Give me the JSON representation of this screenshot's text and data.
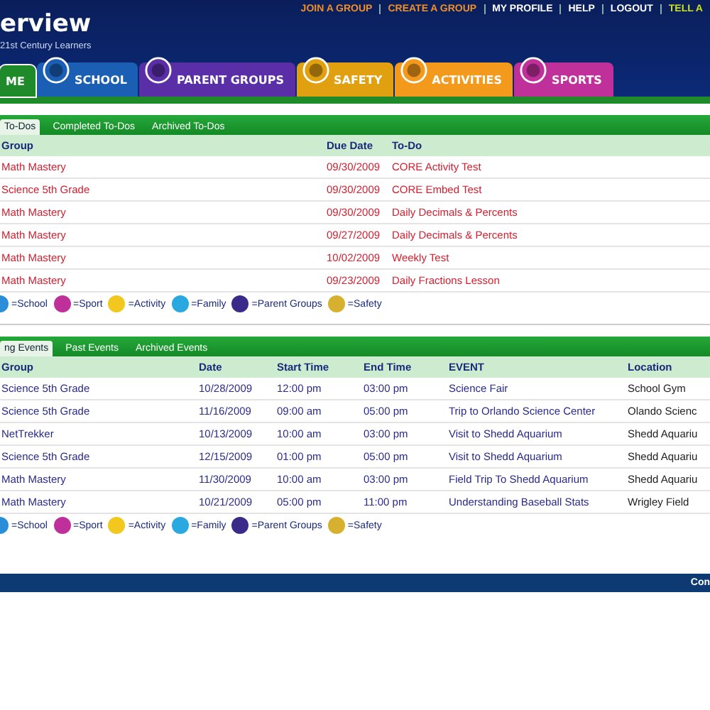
{
  "header": {
    "title": "erview",
    "subtitle": "21st Century Learners",
    "links": [
      {
        "label": "JOIN A GROUP",
        "kind": "accent"
      },
      {
        "label": "CREATE A GROUP",
        "kind": "accent"
      },
      {
        "label": "MY PROFILE",
        "kind": "plain"
      },
      {
        "label": "HELP",
        "kind": "plain"
      },
      {
        "label": "LOGOUT",
        "kind": "plain"
      },
      {
        "label": "TELL A",
        "kind": "highlight"
      }
    ]
  },
  "nav_tabs": [
    {
      "label": "ME",
      "color": "#1f8a2a",
      "selected": true,
      "icon": false
    },
    {
      "label": "SCHOOL",
      "color": "#1a5fb4",
      "selected": false,
      "icon": true
    },
    {
      "label": "PARENT GROUPS",
      "color": "#5a2ea6",
      "selected": false,
      "icon": true
    },
    {
      "label": "SAFETY",
      "color": "#e0a010",
      "selected": false,
      "icon": true
    },
    {
      "label": "ACTIVITIES",
      "color": "#f39a1c",
      "selected": false,
      "icon": true
    },
    {
      "label": "SPORTS",
      "color": "#c0309a",
      "selected": false,
      "icon": true
    }
  ],
  "todos": {
    "tabs": [
      {
        "label": "To-Dos",
        "selected": true
      },
      {
        "label": "Completed To-Dos",
        "selected": false
      },
      {
        "label": "Archived To-Dos",
        "selected": false
      }
    ],
    "columns": [
      "Group",
      "Due Date",
      "To-Do"
    ],
    "rows": [
      [
        "Math Mastery",
        "09/30/2009",
        "CORE Activity Test"
      ],
      [
        "Science 5th Grade",
        "09/30/2009",
        "CORE Embed Test"
      ],
      [
        "Math Mastery",
        "09/30/2009",
        "Daily Decimals & Percents"
      ],
      [
        "Math Mastery",
        "09/27/2009",
        "Daily Decimals & Percents"
      ],
      [
        "Math Mastery",
        "10/02/2009",
        "Weekly Test"
      ],
      [
        "Math Mastery",
        "09/23/2009",
        "Daily Fractions Lesson"
      ]
    ],
    "legend": [
      {
        "label": "=School",
        "color": "#2a8fd8"
      },
      {
        "label": "=Sport",
        "color": "#c0309a"
      },
      {
        "label": "=Activity",
        "color": "#f2c81e"
      },
      {
        "label": "=Family",
        "color": "#2aa8e0"
      },
      {
        "label": "=Parent Groups",
        "color": "#3a2a8a"
      },
      {
        "label": "=Safety",
        "color": "#d8b030"
      }
    ]
  },
  "events": {
    "tabs": [
      {
        "label": "ng Events",
        "selected": true
      },
      {
        "label": "Past Events",
        "selected": false
      },
      {
        "label": "Archived Events",
        "selected": false
      }
    ],
    "columns": [
      "Group",
      "Date",
      "Start Time",
      "End Time",
      "EVENT",
      "Location"
    ],
    "rows": [
      [
        "Science 5th Grade",
        "10/28/2009",
        "12:00 pm",
        "03:00 pm",
        "Science Fair",
        "School Gym"
      ],
      [
        "Science 5th Grade",
        "11/16/2009",
        "09:00 am",
        "05:00 pm",
        "Trip to Orlando Science Center",
        "Olando Scienc"
      ],
      [
        "NetTrekker",
        "10/13/2009",
        "10:00 am",
        "03:00 pm",
        "Visit to Shedd Aquarium",
        "Shedd Aquariu"
      ],
      [
        "Science 5th Grade",
        "12/15/2009",
        "01:00 pm",
        "05:00 pm",
        "Visit to Shedd Aquarium",
        "Shedd Aquariu"
      ],
      [
        "Math Mastery",
        "11/30/2009",
        "10:00 am",
        "03:00 pm",
        "Field Trip To Shedd Aquarium",
        "Shedd Aquariu"
      ],
      [
        "Math Mastery",
        "10/21/2009",
        "05:00 pm",
        "11:00 pm",
        "Understanding Baseball Stats",
        "Wrigley Field"
      ]
    ],
    "legend": [
      {
        "label": "=School",
        "color": "#2a8fd8"
      },
      {
        "label": "=Sport",
        "color": "#c0309a"
      },
      {
        "label": "=Activity",
        "color": "#f2c81e"
      },
      {
        "label": "=Family",
        "color": "#2aa8e0"
      },
      {
        "label": "=Parent Groups",
        "color": "#3a2a8a"
      },
      {
        "label": "=Safety",
        "color": "#d8b030"
      }
    ]
  },
  "footer": {
    "text": "Con"
  }
}
